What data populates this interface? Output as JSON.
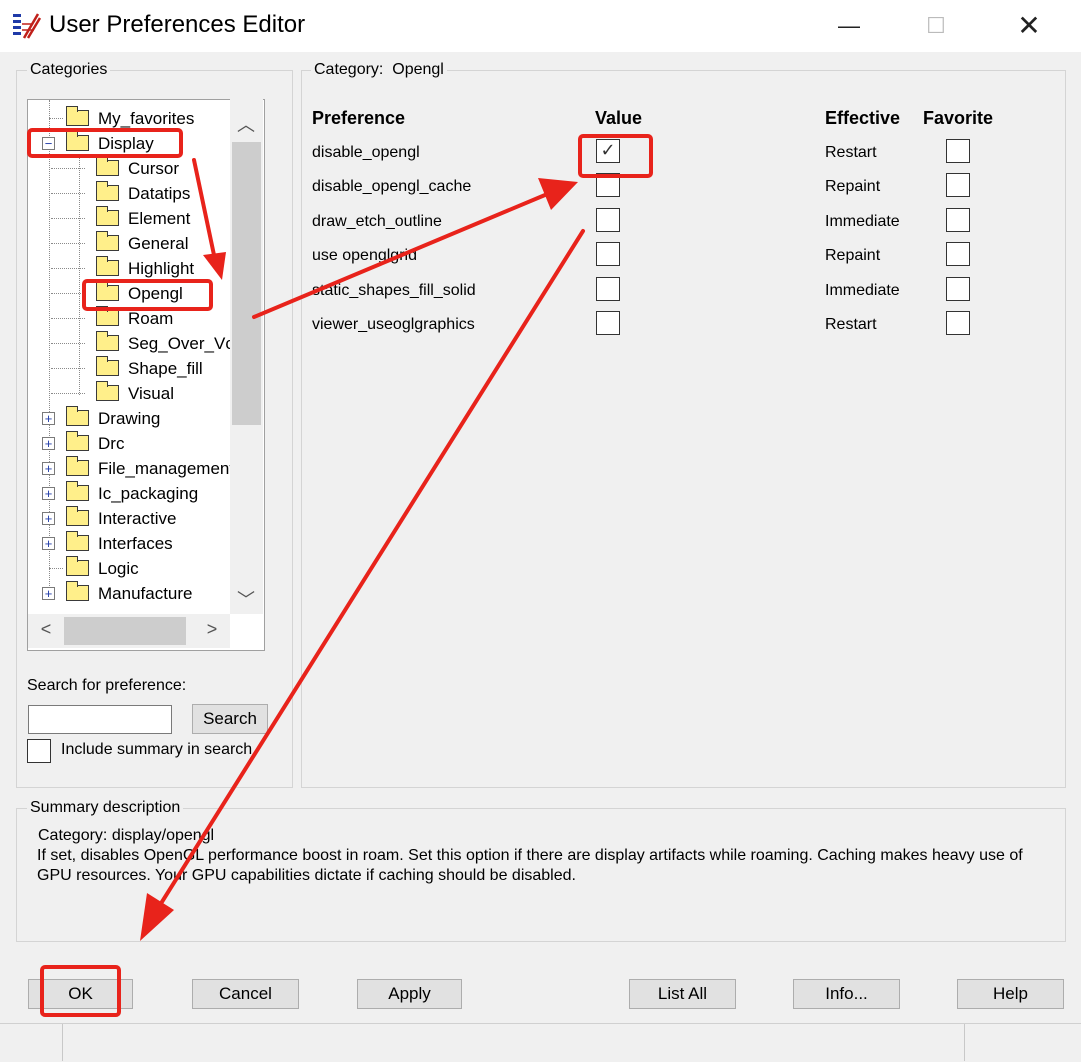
{
  "window": {
    "title": "User Preferences Editor",
    "minimize_glyph": "—",
    "maximize_glyph": "☐",
    "close_glyph": "✕"
  },
  "categories": {
    "group_label": "Categories",
    "items": [
      {
        "label": "My_favorites",
        "level": 0,
        "expander": "none"
      },
      {
        "label": "Display",
        "level": 0,
        "expander": "minus",
        "selected": true
      },
      {
        "label": "Cursor",
        "level": 1
      },
      {
        "label": "Datatips",
        "level": 1
      },
      {
        "label": "Element",
        "level": 1
      },
      {
        "label": "General",
        "level": 1
      },
      {
        "label": "Highlight",
        "level": 1
      },
      {
        "label": "Opengl",
        "level": 1,
        "selected": true
      },
      {
        "label": "Roam",
        "level": 1
      },
      {
        "label": "Seg_Over_Vc",
        "level": 1
      },
      {
        "label": "Shape_fill",
        "level": 1
      },
      {
        "label": "Visual",
        "level": 1
      },
      {
        "label": "Drawing",
        "level": 0,
        "expander": "plus"
      },
      {
        "label": "Drc",
        "level": 0,
        "expander": "plus"
      },
      {
        "label": "File_management",
        "level": 0,
        "expander": "plus"
      },
      {
        "label": "Ic_packaging",
        "level": 0,
        "expander": "plus"
      },
      {
        "label": "Interactive",
        "level": 0,
        "expander": "plus"
      },
      {
        "label": "Interfaces",
        "level": 0,
        "expander": "plus"
      },
      {
        "label": "Logic",
        "level": 0,
        "expander": "none"
      },
      {
        "label": "Manufacture",
        "level": 0,
        "expander": "plus"
      }
    ],
    "scroll_up_glyph": "︿",
    "scroll_down_glyph": "﹀",
    "scroll_left_glyph": "<",
    "scroll_right_glyph": ">"
  },
  "search": {
    "label": "Search for preference:",
    "input_value": "",
    "button_label": "Search",
    "include_summary_label": "Include summary in search",
    "include_summary_checked": false
  },
  "preferences": {
    "category_label": "Category:",
    "category_value": "Opengl",
    "headers": {
      "preference": "Preference",
      "value": "Value",
      "effective": "Effective",
      "favorite": "Favorite"
    },
    "rows": [
      {
        "name": "disable_opengl",
        "value_checked": true,
        "effective": "Restart",
        "favorite": false
      },
      {
        "name": "disable_opengl_cache",
        "value_checked": false,
        "effective": "Repaint",
        "favorite": false
      },
      {
        "name": "draw_etch_outline",
        "value_checked": false,
        "effective": "Immediate",
        "favorite": false
      },
      {
        "name": "use openglgrid",
        "value_checked": false,
        "effective": "Repaint",
        "favorite": false
      },
      {
        "name": "static_shapes_fill_solid",
        "value_checked": false,
        "effective": "Immediate",
        "favorite": false
      },
      {
        "name": "viewer_useoglgraphics",
        "value_checked": false,
        "effective": "Restart",
        "favorite": false
      }
    ],
    "check_glyph": "✓"
  },
  "summary": {
    "group_label": "Summary description",
    "category_line": "Category: display/opengl",
    "text": "If set, disables OpenGL performance boost in roam. Set this option if there are display artifacts while roaming. Caching makes heavy use of GPU resources. Your GPU capabilities dictate if caching should be disabled."
  },
  "buttons": {
    "ok": "OK",
    "cancel": "Cancel",
    "apply": "Apply",
    "list_all": "List All",
    "info": "Info...",
    "help": "Help"
  },
  "colors": {
    "annotation_red": "#e8231b",
    "folder_yellow": "#ffef8a",
    "window_bg": "#f0f0f0"
  }
}
